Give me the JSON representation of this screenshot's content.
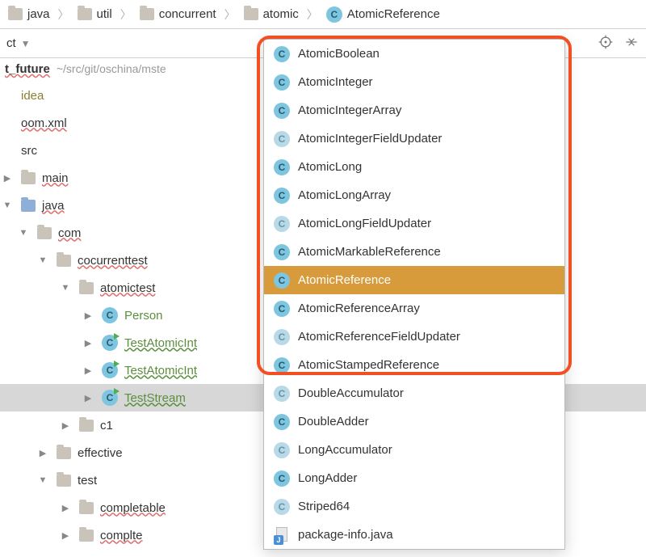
{
  "breadcrumb": [
    {
      "type": "folder",
      "label": "java"
    },
    {
      "type": "folder",
      "label": "util"
    },
    {
      "type": "folder",
      "label": "concurrent"
    },
    {
      "type": "folder",
      "label": "atomic"
    },
    {
      "type": "class",
      "label": "AtomicReference"
    }
  ],
  "toolbar": {
    "dropdown_suffix": "ct"
  },
  "project": {
    "root_name": "t_future",
    "root_path": "~/src/git/oschina/mste"
  },
  "tree": [
    {
      "indent": 0,
      "arrow": "none",
      "icon": "none",
      "label": "idea",
      "style": "olive"
    },
    {
      "indent": 0,
      "arrow": "none",
      "icon": "none",
      "label": "oom.xml",
      "style": "wavy"
    },
    {
      "indent": 0,
      "arrow": "none",
      "icon": "none",
      "label": "src",
      "style": "plain"
    },
    {
      "indent": 1,
      "arrow": "right",
      "icon": "folder",
      "label": "main",
      "style": "wavy"
    },
    {
      "indent": 1,
      "arrow": "down",
      "icon": "folder-blue",
      "label": "java",
      "style": "wavy"
    },
    {
      "indent": 2,
      "arrow": "down",
      "icon": "folder",
      "label": "com",
      "style": "wavy"
    },
    {
      "indent": 3,
      "arrow": "down",
      "icon": "folder",
      "label": "cocurrenttest",
      "style": "wavy"
    },
    {
      "indent": 4,
      "arrow": "down",
      "icon": "folder",
      "label": "atomictest",
      "style": "wavy"
    },
    {
      "indent": 5,
      "arrow": "right",
      "icon": "class",
      "label": "Person",
      "style": "green"
    },
    {
      "indent": 5,
      "arrow": "right",
      "icon": "class-run",
      "label": "TestAtomicInt",
      "style": "green-wavy"
    },
    {
      "indent": 5,
      "arrow": "right",
      "icon": "class-run",
      "label": "TestAtomicInt",
      "style": "green-wavy"
    },
    {
      "indent": 5,
      "arrow": "right",
      "icon": "class-run",
      "label": "TestStream",
      "style": "green-wavy",
      "selected": true
    },
    {
      "indent": 4,
      "arrow": "right",
      "icon": "folder",
      "label": "c1",
      "style": "plain"
    },
    {
      "indent": 3,
      "arrow": "right",
      "icon": "folder",
      "label": "effective",
      "style": "plain"
    },
    {
      "indent": 3,
      "arrow": "down",
      "icon": "folder",
      "label": "test",
      "style": "plain"
    },
    {
      "indent": 4,
      "arrow": "right",
      "icon": "folder",
      "label": "completable",
      "style": "wavy"
    },
    {
      "indent": 4,
      "arrow": "right",
      "icon": "folder",
      "label": "complte",
      "style": "wavy"
    }
  ],
  "dropdown": {
    "items": [
      {
        "icon": "class",
        "label": "AtomicBoolean"
      },
      {
        "icon": "class",
        "label": "AtomicInteger"
      },
      {
        "icon": "class",
        "label": "AtomicIntegerArray"
      },
      {
        "icon": "class-pale",
        "label": "AtomicIntegerFieldUpdater"
      },
      {
        "icon": "class",
        "label": "AtomicLong"
      },
      {
        "icon": "class",
        "label": "AtomicLongArray"
      },
      {
        "icon": "class-pale",
        "label": "AtomicLongFieldUpdater"
      },
      {
        "icon": "class",
        "label": "AtomicMarkableReference"
      },
      {
        "icon": "class",
        "label": "AtomicReference",
        "selected": true
      },
      {
        "icon": "class",
        "label": "AtomicReferenceArray"
      },
      {
        "icon": "class-pale",
        "label": "AtomicReferenceFieldUpdater"
      },
      {
        "icon": "class",
        "label": "AtomicStampedReference"
      },
      {
        "icon": "class-pale",
        "label": "DoubleAccumulator"
      },
      {
        "icon": "class",
        "label": "DoubleAdder"
      },
      {
        "icon": "class-pale",
        "label": "LongAccumulator"
      },
      {
        "icon": "class",
        "label": "LongAdder"
      },
      {
        "icon": "class-pale",
        "label": "Striped64"
      },
      {
        "icon": "java-file",
        "label": "package-info.java"
      }
    ]
  }
}
